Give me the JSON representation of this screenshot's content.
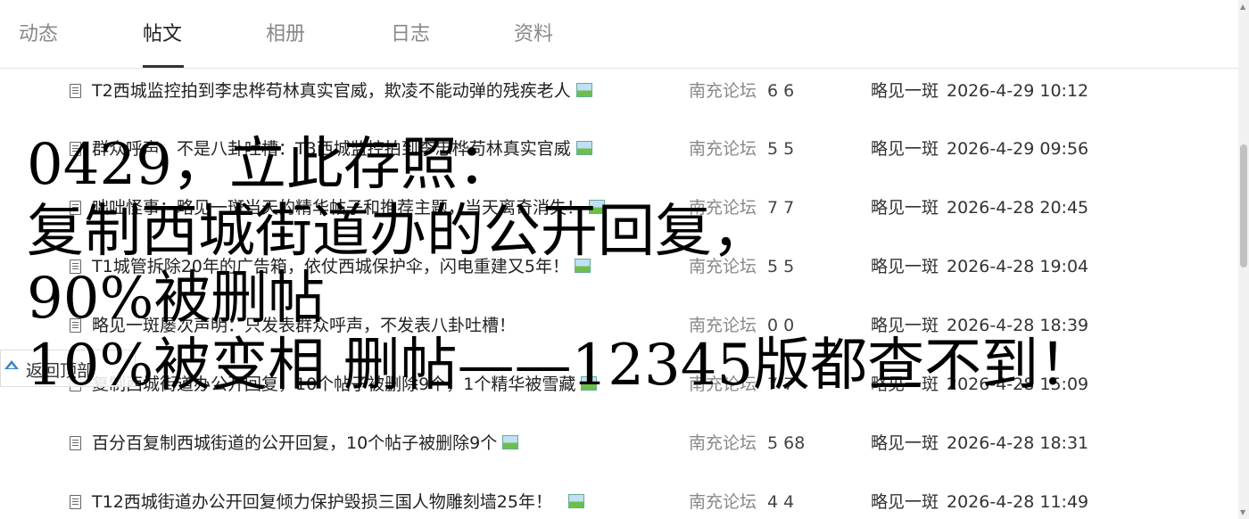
{
  "tabs": [
    {
      "label": "动态",
      "active": false
    },
    {
      "label": "帖文",
      "active": true
    },
    {
      "label": "相册",
      "active": false
    },
    {
      "label": "日志",
      "active": false
    },
    {
      "label": "资料",
      "active": false
    }
  ],
  "posts": [
    {
      "title": "T2西城监控拍到李忠桦苟林真实官威，欺凌不能动弹的残疾老人",
      "has_image": true,
      "forum": "南充论坛",
      "counts": "6 6",
      "author": "略见一斑",
      "date": "2026-4-29 10:12"
    },
    {
      "title": "群众呼声，不是八卦吐槽：T3西城监控拍到李忠桦苟林真实官威",
      "has_image": true,
      "forum": "南充论坛",
      "counts": "5 5",
      "author": "略见一斑",
      "date": "2026-4-29 09:56"
    },
    {
      "title": "咄咄怪事：略见一斑当天的精华帖子和推荐主题，当天离奇消失！",
      "has_image": true,
      "forum": "南充论坛",
      "counts": "7 7",
      "author": "略见一斑",
      "date": "2026-4-28 20:45"
    },
    {
      "title": "T1城管拆除20年的广告箱，依仗西城保护伞，闪电重建又5年！",
      "has_image": true,
      "forum": "南充论坛",
      "counts": "5 5",
      "author": "略见一斑",
      "date": "2026-4-28 19:04"
    },
    {
      "title": "略见一斑屡次声明：只发表群众呼声，不发表八卦吐槽！",
      "has_image": false,
      "forum": "南充论坛",
      "counts": "0 0",
      "author": "略见一斑",
      "date": "2026-4-28 18:39"
    },
    {
      "title": "复制西城街道办公开回复，10个帖子被删除9个，1个精华被雪藏",
      "has_image": true,
      "forum": "南充论坛",
      "counts": "7 7",
      "author": "略见一斑",
      "date": "2026-4-28 15:09"
    },
    {
      "title": "百分百复制西城街道的公开回复，10个帖子被删除9个",
      "has_image": true,
      "forum": "南充论坛",
      "counts": "5 68",
      "author": "略见一斑",
      "date": "2026-4-28 18:31"
    },
    {
      "title": "T12西城街道办公开回复倾力保护毁损三国人物雕刻墙25年！",
      "has_image": true,
      "forum": "南充论坛",
      "counts": "4 4",
      "author": "略见一斑",
      "date": "2026-4-28 11:49"
    }
  ],
  "back_to_top": "返回顶部",
  "overlay_lines": [
    "0429，立此存照：",
    "复制西城街道办的公开回复，",
    "90%被删帖",
    "10%被变相  删帖——12345版都查不到！"
  ]
}
